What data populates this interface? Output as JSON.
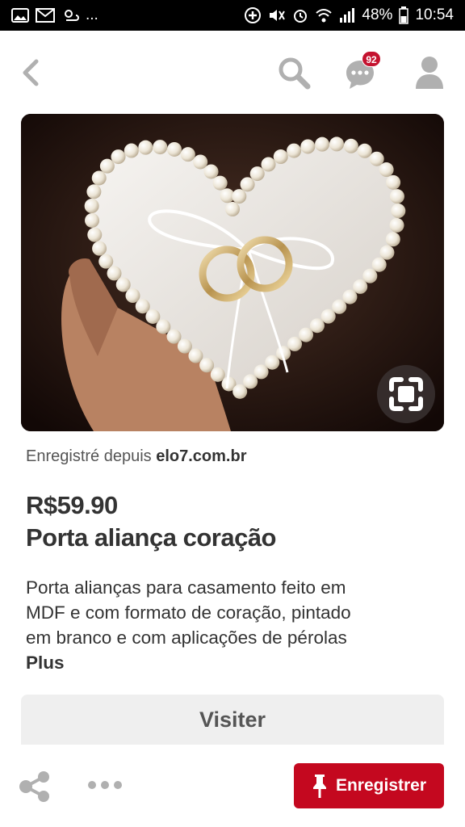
{
  "status_bar": {
    "battery": "48%",
    "time": "10:54",
    "ellipsis": "..."
  },
  "nav": {
    "messages_badge": "92"
  },
  "pin": {
    "saved_from_prefix": "Enregistré depuis",
    "saved_from_domain": "elo7.com.br",
    "price": "R$59.90",
    "title": "Porta aliança coração",
    "description_lines": [
      "Porta alianças para casamento feito em",
      "MDF e com formato de coração, pintado",
      "em branco e com aplicações de pérolas"
    ],
    "more_label": "Plus",
    "visit_label": "Visiter",
    "save_label": "Enregistrer"
  },
  "colors": {
    "brand_red": "#c4081f",
    "icon_grey": "#b0b0b0",
    "text_dark": "#333333"
  },
  "icons": [
    "back-chevron-icon",
    "search-icon",
    "messages-icon",
    "profile-icon",
    "lens-icon",
    "share-icon",
    "more-icon",
    "pin-icon"
  ]
}
